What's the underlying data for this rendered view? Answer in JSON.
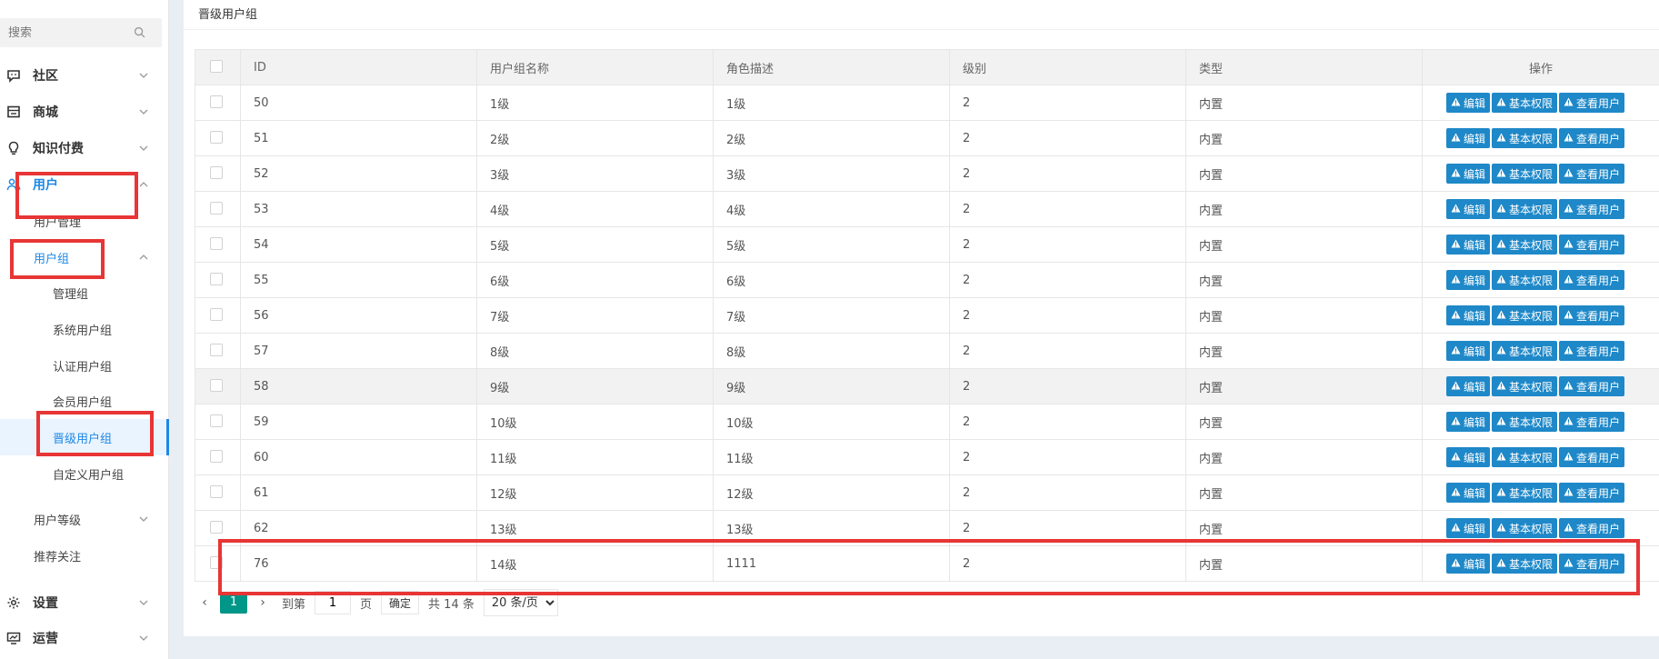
{
  "sidebar": {
    "search_placeholder": "搜索",
    "menus": [
      {
        "label": "社区",
        "icon": "chat-icon"
      },
      {
        "label": "商城",
        "icon": "store-icon"
      },
      {
        "label": "知识付费",
        "icon": "lightbulb-icon"
      },
      {
        "label": "用户",
        "icon": "users-icon"
      },
      {
        "label": "设置",
        "icon": "gear-icon"
      },
      {
        "label": "运营",
        "icon": "monitor-icon"
      }
    ],
    "user_submenu": {
      "user_manage": "用户管理",
      "user_group": "用户组",
      "user_level": "用户等级",
      "recommend_follow": "推荐关注"
    },
    "group_items": [
      "管理组",
      "系统用户组",
      "认证用户组",
      "会员用户组",
      "晋级用户组",
      "自定义用户组"
    ]
  },
  "header": {
    "title": "晋级用户组"
  },
  "table": {
    "columns": [
      "ID",
      "用户组名称",
      "角色描述",
      "级别",
      "类型",
      "操作"
    ],
    "actions": [
      "编辑",
      "基本权限",
      "查看用户"
    ],
    "rows": [
      {
        "id": "50",
        "name": "1级",
        "desc": "1级",
        "level": "2",
        "type": "内置"
      },
      {
        "id": "51",
        "name": "2级",
        "desc": "2级",
        "level": "2",
        "type": "内置"
      },
      {
        "id": "52",
        "name": "3级",
        "desc": "3级",
        "level": "2",
        "type": "内置"
      },
      {
        "id": "53",
        "name": "4级",
        "desc": "4级",
        "level": "2",
        "type": "内置"
      },
      {
        "id": "54",
        "name": "5级",
        "desc": "5级",
        "level": "2",
        "type": "内置"
      },
      {
        "id": "55",
        "name": "6级",
        "desc": "6级",
        "level": "2",
        "type": "内置"
      },
      {
        "id": "56",
        "name": "7级",
        "desc": "7级",
        "level": "2",
        "type": "内置"
      },
      {
        "id": "57",
        "name": "8级",
        "desc": "8级",
        "level": "2",
        "type": "内置"
      },
      {
        "id": "58",
        "name": "9级",
        "desc": "9级",
        "level": "2",
        "type": "内置"
      },
      {
        "id": "59",
        "name": "10级",
        "desc": "10级",
        "level": "2",
        "type": "内置"
      },
      {
        "id": "60",
        "name": "11级",
        "desc": "11级",
        "level": "2",
        "type": "内置"
      },
      {
        "id": "61",
        "name": "12级",
        "desc": "12级",
        "level": "2",
        "type": "内置"
      },
      {
        "id": "62",
        "name": "13级",
        "desc": "13级",
        "level": "2",
        "type": "内置"
      },
      {
        "id": "76",
        "name": "14级",
        "desc": "1111",
        "level": "2",
        "type": "内置"
      }
    ]
  },
  "pagination": {
    "current_page": "1",
    "goto_label": "到第",
    "page_input": "1",
    "page_unit": "页",
    "confirm_label": "确定",
    "total_label": "共 14 条",
    "page_size_option": "20 条/页"
  },
  "colors": {
    "accent": "#1e88e5",
    "button": "#1e88c8",
    "page_active": "#009688",
    "annotation": "#e83535"
  }
}
